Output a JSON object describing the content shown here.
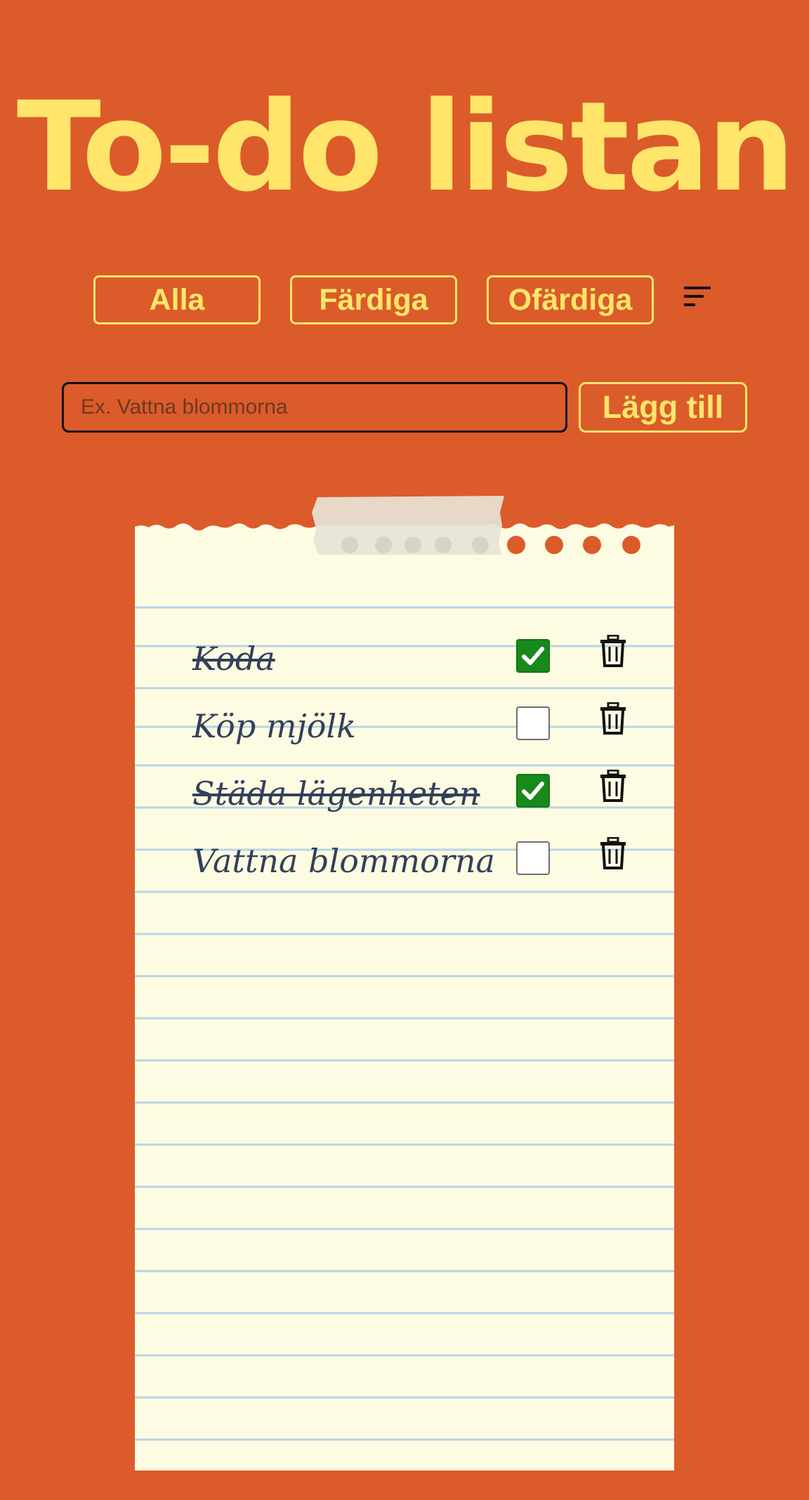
{
  "app": {
    "title": "To-do listan"
  },
  "filters": [
    {
      "label": "Alla"
    },
    {
      "label": "Färdiga"
    },
    {
      "label": "Ofärdiga"
    }
  ],
  "sort_icon": "sort-icon",
  "add_form": {
    "placeholder": "Ex. Vattna blommorna",
    "value": "",
    "button_label": "Lägg till"
  },
  "todos": [
    {
      "text": "Koda",
      "done": true
    },
    {
      "text": "Köp mjölk",
      "done": false
    },
    {
      "text": "Städa lägenheten",
      "done": true
    },
    {
      "text": "Vattna blommorna",
      "done": false
    }
  ],
  "item_icons": {
    "checkmark": "checkmark-icon",
    "delete": "trash-icon"
  },
  "colors": {
    "background": "#DC5B2A",
    "accent": "#FFE66A",
    "paper": "#FDFCE2",
    "ruled_line": "#B9D3E6",
    "ink": "#33405A",
    "checked": "#178A1B"
  }
}
